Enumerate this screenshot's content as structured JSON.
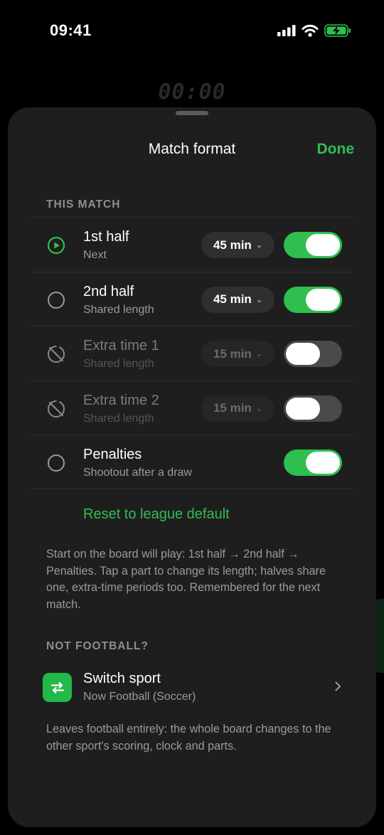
{
  "status": {
    "time": "09:41"
  },
  "background": {
    "timer": "00:00"
  },
  "sheet": {
    "title": "Match format",
    "done": "Done",
    "this_match_header": "THIS MATCH",
    "parts": [
      {
        "title": "1st half",
        "subtitle": "Next",
        "length": "45 min",
        "enabled": true,
        "state": "next",
        "icon": "play-circle-icon"
      },
      {
        "title": "2nd half",
        "subtitle": "Shared length",
        "length": "45 min",
        "enabled": true,
        "state": "pending",
        "icon": "empty-circle-icon"
      },
      {
        "title": "Extra time 1",
        "subtitle": "Shared length",
        "length": "15 min",
        "enabled": false,
        "state": "off",
        "icon": "disabled-circle-icon"
      },
      {
        "title": "Extra time 2",
        "subtitle": "Shared length",
        "length": "15 min",
        "enabled": false,
        "state": "off",
        "icon": "disabled-circle-icon"
      },
      {
        "title": "Penalties",
        "subtitle": "Shootout after a draw",
        "enabled": true,
        "state": "pending",
        "icon": "empty-circle-icon"
      }
    ],
    "reset": "Reset to league default",
    "explanation": "Start on the board will play: 1st half → 2nd half → Penalties. Tap a part to change its length; halves share one, extra-time periods too. Remembered for the next match.",
    "not_football_header": "NOT FOOTBALL?",
    "switch_sport": {
      "title": "Switch sport",
      "subtitle": "Now Football (Soccer)",
      "icon": "swap-arrows-icon"
    },
    "switch_note": "Leaves football entirely: the whole board changes to the other sport's scoring, clock and parts."
  },
  "colors": {
    "accent": "#2fbf4f",
    "sheet": "#1e1e1f",
    "secondary_text": "#9a9a9e"
  }
}
